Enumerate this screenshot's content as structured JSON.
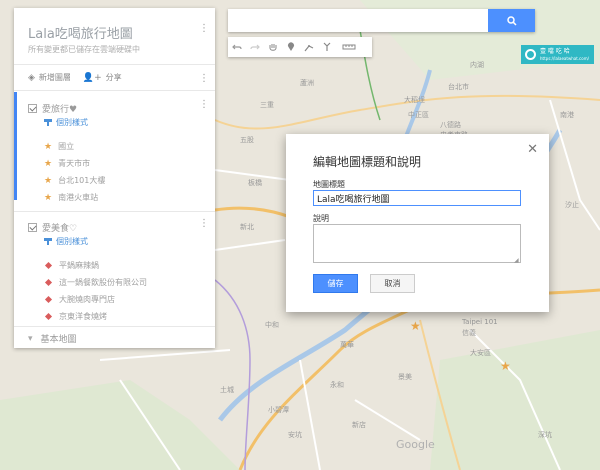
{
  "map": {
    "labels": [
      "板橋",
      "台北市",
      "新北",
      "大安區",
      "中和",
      "南港",
      "Taipei 101",
      "信義",
      "内湖",
      "萬華",
      "土城",
      "永和",
      "景美",
      "深坑",
      "安坑",
      "新店",
      "小碧潭",
      "中正區",
      "大稻埕",
      "汐止",
      "三重",
      "蘆洲",
      "五股",
      "八德路",
      "忠孝東路",
      "Google"
    ],
    "google_logo": "Google"
  },
  "panel": {
    "title": "Lala吃喝旅行地圖",
    "description": "所有變更都已儲存在雲端硬碟中",
    "add_layer": "新增圖層",
    "share": "分享",
    "layers": [
      {
        "name": "愛旅行♥",
        "style_link": "個別樣式",
        "places": [
          "國立",
          "青天市市",
          "台北101大樓",
          "南港火車站"
        ]
      },
      {
        "name": "愛美食♡",
        "style_link": "個別樣式",
        "places": [
          "平鍋麻辣鍋",
          "這一鍋餐飲股份有限公司",
          "大腕燒肉專門店",
          "京東洋食燒烤"
        ]
      }
    ],
    "base_map": "基本地圖"
  },
  "search": {
    "placeholder": "",
    "value": ""
  },
  "toolbar": {
    "icons": [
      "undo-icon",
      "redo-icon",
      "pan-hand-icon",
      "add-marker-icon",
      "draw-line-icon",
      "directions-icon",
      "measure-icon"
    ]
  },
  "badge": {
    "text_line1": "壹 噹 吃 哈",
    "text_line2": "https://lalaeatwhat.com/"
  },
  "dialog": {
    "title": "編輯地圖標題和說明",
    "title_label": "地圖標題",
    "title_value": "Lala吃喝旅行地圖",
    "description_label": "說明",
    "description_value": "",
    "save_label": "儲存",
    "cancel_label": "取消"
  },
  "colors": {
    "accent": "#4d90fe",
    "star": "#e8a64b",
    "food_marker": "#d95c5c",
    "badge": "#2fb8c4"
  }
}
